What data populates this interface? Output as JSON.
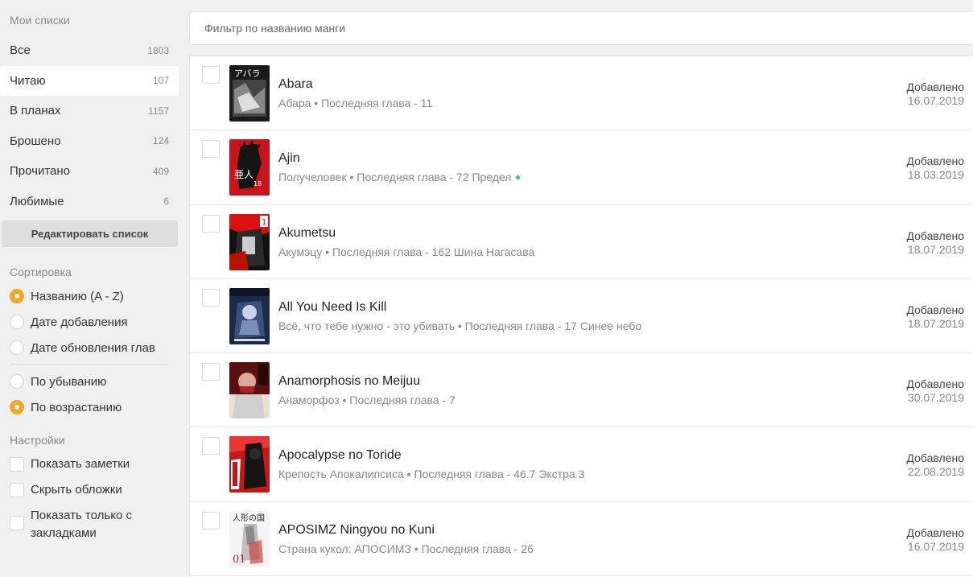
{
  "sidebar": {
    "lists_heading": "Мои списки",
    "lists": [
      {
        "label": "Все",
        "count": "1803"
      },
      {
        "label": "Читаю",
        "count": "107"
      },
      {
        "label": "В планах",
        "count": "1157"
      },
      {
        "label": "Брошено",
        "count": "124"
      },
      {
        "label": "Прочитано",
        "count": "409"
      },
      {
        "label": "Любимые",
        "count": "6"
      }
    ],
    "active_list": "Читаю",
    "edit_button": "Редактировать список",
    "sort_heading": "Сортировка",
    "sort_by": [
      {
        "label": "Названию (A - Z)",
        "checked": true
      },
      {
        "label": "Дате добавления",
        "checked": false
      },
      {
        "label": "Дате обновления глав",
        "checked": false
      }
    ],
    "sort_order": [
      {
        "label": "По убыванию",
        "checked": false
      },
      {
        "label": "По возрастанию",
        "checked": true
      }
    ],
    "settings_heading": "Настройки",
    "settings": [
      {
        "label": "Показать заметки",
        "checked": false
      },
      {
        "label": "Скрыть обложки",
        "checked": false
      },
      {
        "label": "Показать только с закладками",
        "checked": false
      }
    ]
  },
  "filter": {
    "placeholder": "Фильтр по названию манги",
    "value": ""
  },
  "manga": [
    {
      "title": "Abara",
      "subtitle": "Абара • Последняя глава - 11",
      "added_label": "Добавлено",
      "date": "16.07.2019",
      "new": false,
      "cover_icon": "abara-cover-image"
    },
    {
      "title": "Ajin",
      "subtitle": "Получеловек • Последняя глава - 72 Предел",
      "added_label": "Добавлено",
      "date": "18.03.2019",
      "new": true,
      "cover_icon": "ajin-cover-image"
    },
    {
      "title": "Akumetsu",
      "subtitle": "Акумэцу • Последняя глава - 162 Шина Нагасава",
      "added_label": "Добавлено",
      "date": "18.07.2019",
      "new": false,
      "cover_icon": "akumetsu-cover-image"
    },
    {
      "title": "All You Need Is Kill",
      "subtitle": "Всё, что тебе нужно - это убивать • Последняя глава - 17 Синее небо",
      "added_label": "Добавлено",
      "date": "18.07.2019",
      "new": false,
      "cover_icon": "all-you-need-is-kill-cover-image"
    },
    {
      "title": "Anamorphosis no Meijuu",
      "subtitle": "Анаморфоз • Последняя глава - 7",
      "added_label": "Добавлено",
      "date": "30.07.2019",
      "new": false,
      "cover_icon": "anamorphosis-cover-image"
    },
    {
      "title": "Apocalypse no Toride",
      "subtitle": "Крепость Апокалипсиса • Последняя глава - 46.7 Экстра 3",
      "added_label": "Добавлено",
      "date": "22.08.2019",
      "new": false,
      "cover_icon": "apocalypse-cover-image"
    },
    {
      "title": "APOSIMZ Ningyou no Kuni",
      "subtitle": "Страна кукол: АПОСИМЗ • Последняя глава - 26",
      "added_label": "Добавлено",
      "date": "16.07.2019",
      "new": false,
      "cover_icon": "aposimz-cover-image"
    }
  ],
  "colors": {
    "accent": "#f5a623",
    "new_indicator": "#2ecc71",
    "background": "#f0f0f0"
  }
}
